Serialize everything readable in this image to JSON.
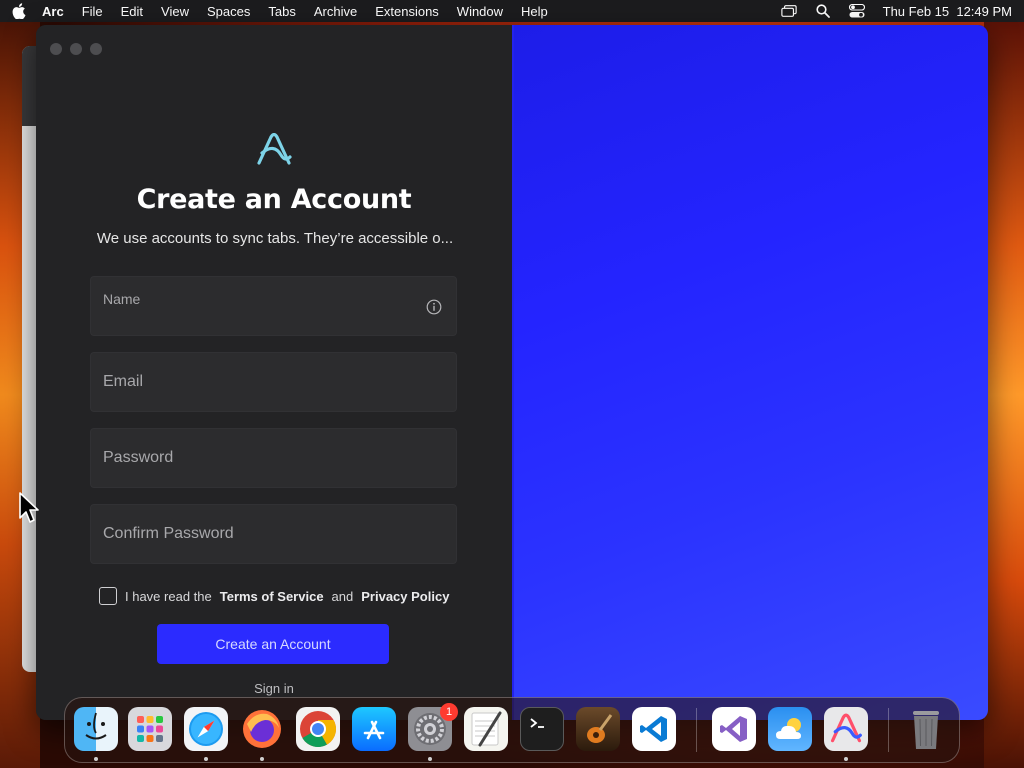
{
  "menubar": {
    "app_name": "Arc",
    "items": [
      "File",
      "Edit",
      "View",
      "Spaces",
      "Tabs",
      "Archive",
      "Extensions",
      "Window",
      "Help"
    ],
    "clock": "Thu Feb 15  12:49 PM"
  },
  "signup": {
    "title": "Create an Account",
    "subtitle": "We use accounts to sync tabs. They’re accessible o...",
    "fields": {
      "name_label": "Name",
      "email_placeholder": "Email",
      "password_placeholder": "Password",
      "confirm_placeholder": "Confirm Password"
    },
    "terms": {
      "prefix": "I have read the",
      "tos": "Terms of Service",
      "and": "and",
      "privacy": "Privacy Policy"
    },
    "primary_button": "Create an Account",
    "sign_in": "Sign in"
  },
  "dock": {
    "apps": [
      "Finder",
      "Launchpad",
      "Safari",
      "Firefox",
      "Chrome",
      "App Store",
      "System Settings",
      "TextEdit",
      "Terminal",
      "GarageBand",
      "Visual Studio Code",
      "Visual Studio",
      "Weather",
      "Arc",
      "Trash"
    ],
    "settings_badge": "1"
  },
  "colors": {
    "accent": "#2b2bff",
    "panel_bg": "#232325",
    "field_bg": "#2c2c2e",
    "blue_pane": "#2424ff"
  }
}
